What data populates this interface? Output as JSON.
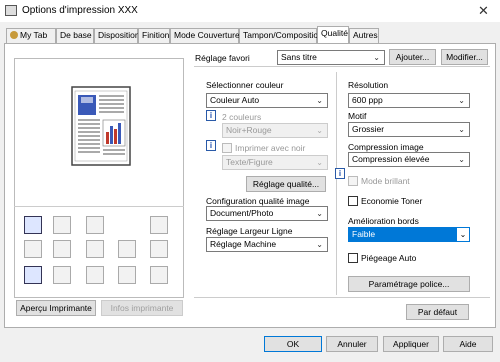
{
  "window": {
    "title": "Options d'impression XXX"
  },
  "tabs": [
    {
      "label": "My Tab"
    },
    {
      "label": "De base"
    },
    {
      "label": "Disposition"
    },
    {
      "label": "Finition"
    },
    {
      "label": "Mode Couverture"
    },
    {
      "label": "Tampon/Composition"
    },
    {
      "label": "Qualité"
    },
    {
      "label": "Autres"
    }
  ],
  "favorite": {
    "label": "Réglage favori",
    "value": "Sans titre",
    "add_label": "Ajouter...",
    "modify_label": "Modifier..."
  },
  "color": {
    "label": "Sélectionner couleur",
    "value": "Couleur Auto"
  },
  "two_colors": {
    "label": "2 couleurs",
    "value": "Noir+Rouge"
  },
  "print_black": {
    "label": "Imprimer avec noir",
    "value": "Texte/Figure"
  },
  "quality_settings_button": "Réglage qualité...",
  "image_quality": {
    "label": "Configuration qualité image",
    "value": "Document/Photo"
  },
  "line_width": {
    "label": "Réglage Largeur Ligne",
    "value": "Réglage Machine"
  },
  "resolution": {
    "label": "Résolution",
    "value": "600 ppp"
  },
  "pattern": {
    "label": "Motif",
    "value": "Grossier"
  },
  "compression": {
    "label": "Compression image",
    "value": "Compression élevée"
  },
  "glossy": {
    "label": "Mode brillant"
  },
  "toner_saving": {
    "label": "Economie Toner"
  },
  "edge_enhance": {
    "label": "Amélioration bords",
    "value": "Faible"
  },
  "auto_trapping": {
    "label": "Piégeage Auto"
  },
  "font_settings_button": "Paramétrage police...",
  "default_button": "Par défaut",
  "printer_view_button": "Aperçu Imprimante",
  "printer_info_button": "Infos imprimante",
  "footer": {
    "ok": "OK",
    "cancel": "Annuler",
    "apply": "Appliquer",
    "help": "Aide"
  },
  "info_glyph": "i",
  "close_glyph": "✕",
  "dropdown_glyph": "⌄"
}
